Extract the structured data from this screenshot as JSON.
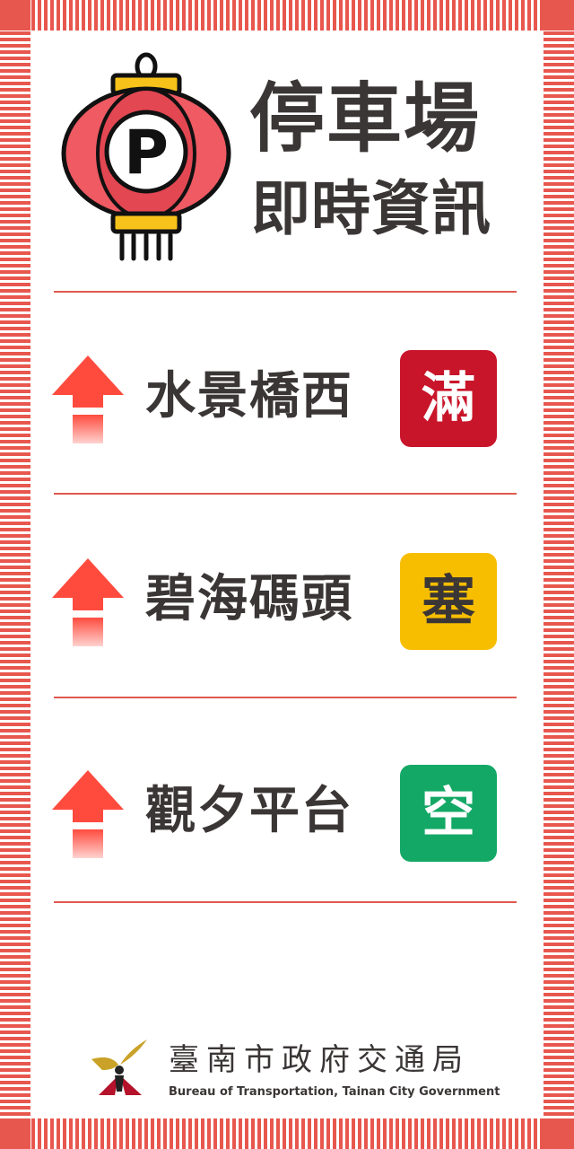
{
  "header": {
    "title_line1": "停車場",
    "title_line2": "即時資訊",
    "lantern_letter": "P",
    "icon": "parking-lantern-icon"
  },
  "parking_lots": [
    {
      "name": "水景橋西",
      "status": "滿",
      "status_color": "#c8152a",
      "arrow_icon": "up-arrow-icon"
    },
    {
      "name": "碧海碼頭",
      "status": "塞",
      "status_color": "#f7be00",
      "status_text_color": "#3b3636",
      "arrow_icon": "up-arrow-icon"
    },
    {
      "name": "觀夕平台",
      "status": "空",
      "status_color": "#14a866",
      "arrow_icon": "up-arrow-icon"
    }
  ],
  "footer": {
    "org_name_zh": "臺南市政府交通局",
    "org_name_en": "Bureau of Transportation, Tainan City Government"
  },
  "colors": {
    "stripe": "#e8574e",
    "divider": "#e0594f",
    "arrow": "#ff4b3e",
    "text": "#3b3636"
  }
}
